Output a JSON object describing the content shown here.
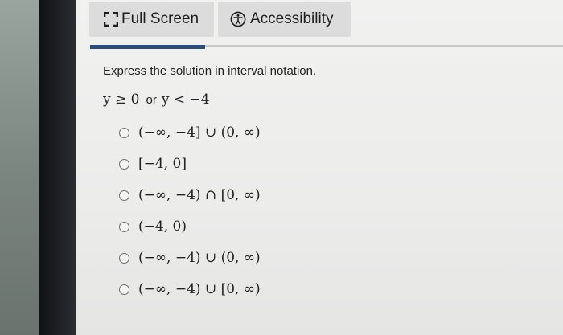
{
  "toolbar": {
    "full_screen_label": "Full Screen",
    "accessibility_label": "Accessibility",
    "full_screen_icon": "expand-corners-icon",
    "accessibility_icon": "accessibility-person-icon"
  },
  "question": {
    "prompt": "Express the solution in interval notation.",
    "condition_left": "y ≥ 0",
    "condition_or": "or",
    "condition_right": "y < −4"
  },
  "options": [
    {
      "label": "(−∞, −4] ∪ (0, ∞)"
    },
    {
      "label": "[−4, 0]"
    },
    {
      "label": "(−∞, −4) ∩ [0, ∞)"
    },
    {
      "label": "(−4, 0)"
    },
    {
      "label": "(−∞, −4) ∪ (0, ∞)"
    },
    {
      "label": "(−∞, −4) ∪ [0, ∞)"
    }
  ],
  "colors": {
    "accent": "#2b4f7c",
    "button_bg": "#dcdcdc",
    "page_bg": "#efefee"
  }
}
